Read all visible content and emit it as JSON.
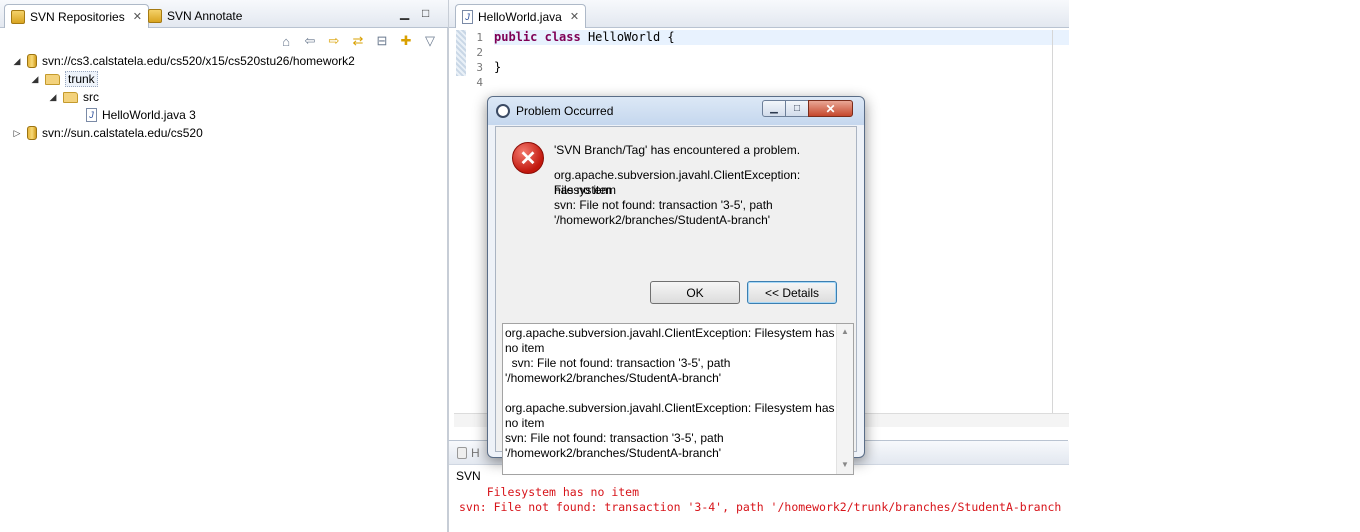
{
  "left_view": {
    "tabs": [
      {
        "label": "SVN Repositories",
        "active": true
      },
      {
        "label": "SVN Annotate",
        "active": false
      }
    ],
    "toolbar_icons": [
      "home-icon",
      "back-arrow-icon",
      "forward-arrow-icon",
      "link-icon",
      "collapse-all-icon",
      "new-repository-icon",
      "view-menu-icon"
    ],
    "tree": {
      "repo1": "svn://cs3.calstatela.edu/cs520/x15/cs520stu26/homework2",
      "trunk": "trunk",
      "src": "src",
      "file": "HelloWorld.java 3",
      "repo2": "svn://sun.calstatela.edu/cs520"
    }
  },
  "editor": {
    "tab_label": "HelloWorld.java",
    "line_numbers": [
      "1",
      "2",
      "3",
      "4"
    ],
    "code": {
      "kw1": "public",
      "kw2": "class",
      "rest1": " HelloWorld {",
      "line3": "}"
    }
  },
  "console": {
    "tab_label": "H",
    "title": "SVN",
    "lines": [
      "    Filesystem has no item",
      "svn: File not found: transaction '3-4', path '/homework2/trunk/branches/StudentA-branch"
    ]
  },
  "dialog": {
    "title": "Problem Occurred",
    "message": "'SVN Branch/Tag' has encountered a problem.",
    "reason_lines": [
      "org.apache.subversion.javahl.ClientException: Filesystem",
      "has no item",
      "svn: File not found: transaction '3-5', path",
      "'/homework2/branches/StudentA-branch'"
    ],
    "ok_label": "OK",
    "details_label": "<< Details",
    "details_lines": [
      "org.apache.subversion.javahl.ClientException: Filesystem has",
      "no item",
      "  svn: File not found: transaction '3-5', path",
      "'/homework2/branches/StudentA-branch'",
      "",
      "org.apache.subversion.javahl.ClientException: Filesystem has",
      "no item",
      "svn: File not found: transaction '3-5', path",
      "'/homework2/branches/StudentA-branch'"
    ],
    "window_buttons": {
      "minimize": "▁",
      "maximize": "□",
      "close": "✕"
    }
  },
  "colors": {
    "error_text": "#d7141a",
    "keyword": "#7f0055",
    "current_line": "#e8f2fe"
  }
}
